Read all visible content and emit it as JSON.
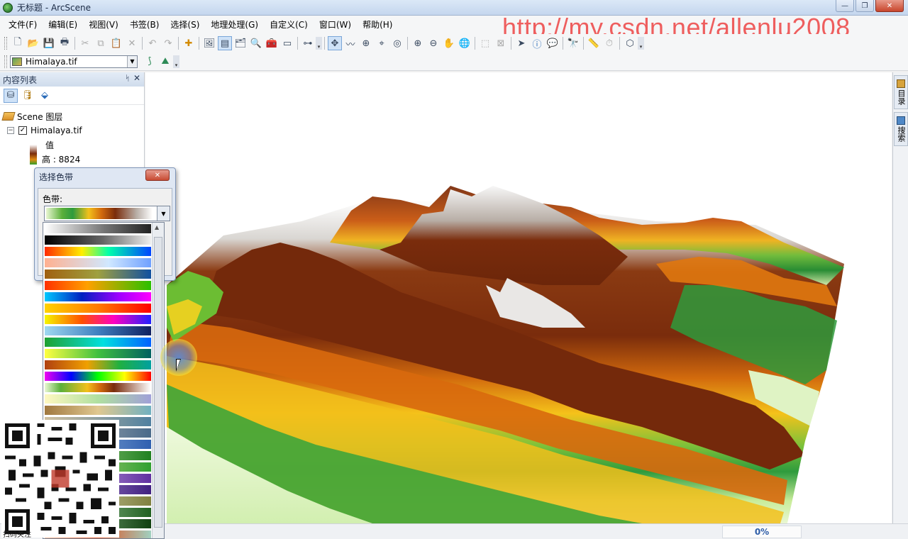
{
  "window": {
    "title": "无标题 - ArcScene",
    "controls": [
      "—",
      "❐",
      "✕"
    ]
  },
  "menu": [
    "文件(F)",
    "编辑(E)",
    "视图(V)",
    "书签(B)",
    "选择(S)",
    "地理处理(G)",
    "自定义(C)",
    "窗口(W)",
    "帮助(H)"
  ],
  "watermark": "http://my.csdn.net/allenlu2008",
  "toolbar": {
    "layer_select": "Himalaya.tif"
  },
  "toc": {
    "title": "内容列表",
    "pin": "ᛋ",
    "close": "✕",
    "scene_layers": "Scene 图层",
    "layer_name": "Himalaya.tif",
    "layer_checked": "✓",
    "value_label": "值",
    "high_label": "高 : 8824"
  },
  "right_strip": {
    "catalog": "目录",
    "search": "搜索"
  },
  "dialog": {
    "title": "选择色带",
    "close": "✕",
    "ramp_label": "色带:"
  },
  "status": {
    "progress": "0%"
  },
  "qr_caption": "扫码关注"
}
